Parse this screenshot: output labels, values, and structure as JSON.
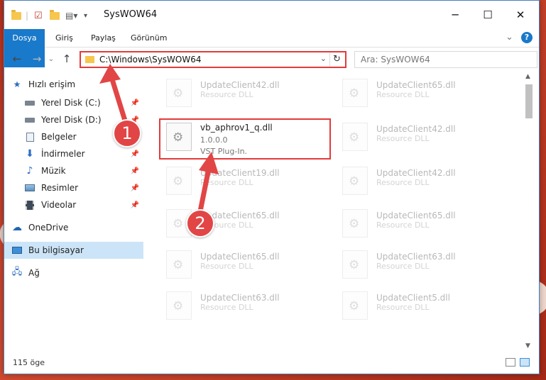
{
  "window": {
    "title": "SysWOW64",
    "minimize": "─",
    "maximize": "☐",
    "close": "✕"
  },
  "ribbon": {
    "tabs": [
      "Dosya",
      "Giriş",
      "Paylaş",
      "Görünüm"
    ],
    "help": "?",
    "expand": "⌄"
  },
  "nav": {
    "back": "←",
    "forward": "→",
    "down": "⌄",
    "up": "↑",
    "address": "C:\\Windows\\SysWOW64",
    "dropdown": "⌄",
    "refresh": "↻",
    "search_placeholder": "Ara: SysWOW64"
  },
  "sidebar": {
    "quick_access": "Hızlı erişim",
    "items": [
      {
        "label": "Yerel Disk (C:)",
        "icon": "drive-icon"
      },
      {
        "label": "Yerel Disk (D:)",
        "icon": "drive-icon"
      },
      {
        "label": "Belgeler",
        "icon": "documents-icon"
      },
      {
        "label": "İndirmeler",
        "icon": "download-icon"
      },
      {
        "label": "Müzik",
        "icon": "music-icon"
      },
      {
        "label": "Resimler",
        "icon": "pictures-icon"
      },
      {
        "label": "Videolar",
        "icon": "videos-icon"
      }
    ],
    "onedrive": "OneDrive",
    "this_pc": "Bu bilgisayar",
    "network": "Ağ"
  },
  "files": {
    "highlighted": {
      "name": "vb_aphrov1_q.dll",
      "version": "1.0.0.0",
      "type": "VST Plug-In."
    },
    "left": [
      {
        "name": "UpdateClient42.dll",
        "type": "Resource DLL"
      },
      {
        "name": "UpdateClient19.dll",
        "type": "Resource DLL"
      },
      {
        "name": "UpdateClient65.dll",
        "type": "Resource DLL"
      },
      {
        "name": "UpdateClient65.dll",
        "type": "Resource DLL"
      },
      {
        "name": "UpdateClient63.dll",
        "type": "Resource DLL"
      }
    ],
    "right": [
      {
        "name": "UpdateClient65.dll",
        "type": "Resource DLL"
      },
      {
        "name": "UpdateClient42.dll",
        "type": "Resource DLL"
      },
      {
        "name": "UpdateClient42.dll",
        "type": "Resource DLL"
      },
      {
        "name": "UpdateClient65.dll",
        "type": "Resource DLL"
      },
      {
        "name": "UpdateClient63.dll",
        "type": "Resource DLL"
      },
      {
        "name": "UpdateClient5.dll",
        "type": "Resource DLL"
      }
    ]
  },
  "status": {
    "count": "115 öge"
  },
  "annotations": {
    "step1": "1",
    "step2": "2"
  },
  "colors": {
    "accent": "#1979ca",
    "highlight": "#e33a3a",
    "annotation": "#e24545"
  }
}
